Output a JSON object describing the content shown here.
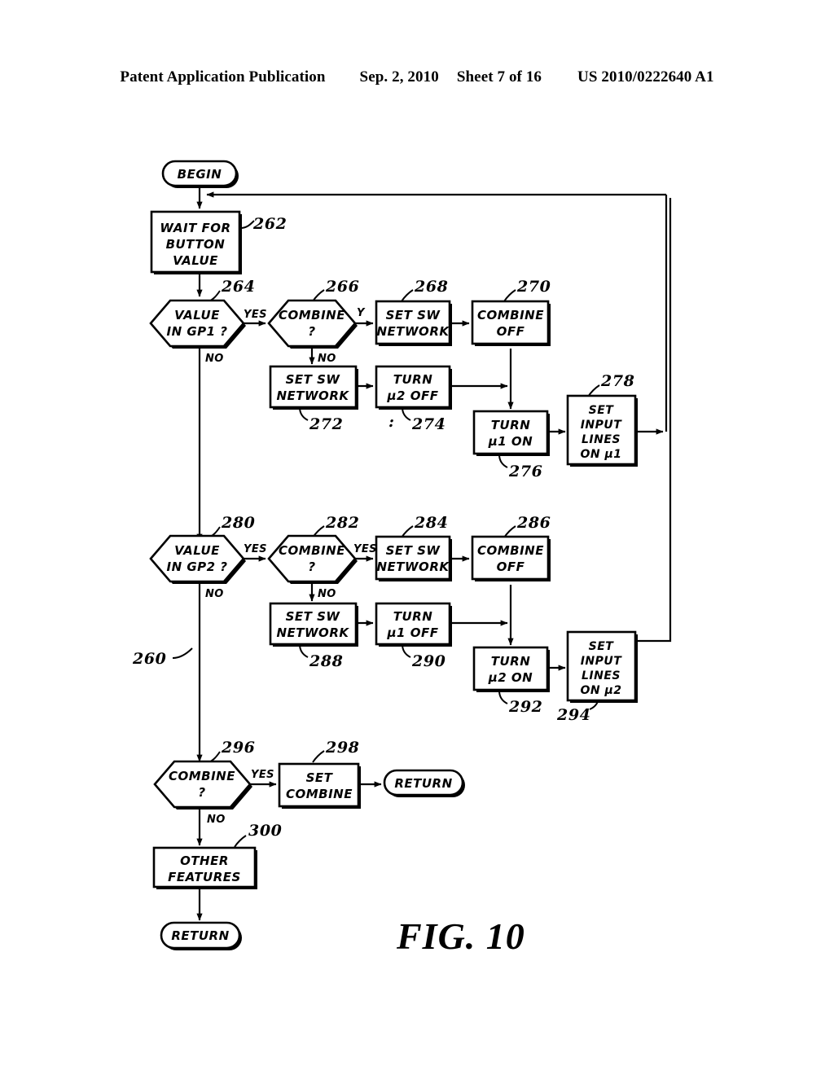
{
  "header": {
    "publication": "Patent Application Publication",
    "date": "Sep. 2, 2010",
    "sheet": "Sheet 7 of 16",
    "number": "US 2010/0222640 A1"
  },
  "figure": {
    "title": "FIG. 10",
    "diagram_ref": "260"
  },
  "nodes": [
    {
      "id": "begin",
      "type": "terminal",
      "label": "BEGIN",
      "ref": ""
    },
    {
      "id": "n262",
      "type": "process",
      "label": "WAIT FOR\nBUTTON\nVALUE",
      "ref": "262"
    },
    {
      "id": "n264",
      "type": "decision",
      "label": "VALUE\nIN GP1 ?",
      "ref": "264"
    },
    {
      "id": "n266",
      "type": "decision",
      "label": "COMBINE\n?",
      "ref": "266"
    },
    {
      "id": "n268",
      "type": "process",
      "label": "SET SW\nNETWORK",
      "ref": "268"
    },
    {
      "id": "n270",
      "type": "process",
      "label": "COMBINE\nOFF",
      "ref": "270"
    },
    {
      "id": "n272",
      "type": "process",
      "label": "SET SW\nNETWORK",
      "ref": "272"
    },
    {
      "id": "n274",
      "type": "process",
      "label": "TURN\nµ2 OFF",
      "ref": "274"
    },
    {
      "id": "n276",
      "type": "process",
      "label": "TURN\nµ1 ON",
      "ref": "276"
    },
    {
      "id": "n278",
      "type": "process",
      "label": "SET\nINPUT\nLINES\nON µ1",
      "ref": "278"
    },
    {
      "id": "n280",
      "type": "decision",
      "label": "VALUE\nIN GP2 ?",
      "ref": "280"
    },
    {
      "id": "n282",
      "type": "decision",
      "label": "COMBINE\n?",
      "ref": "282"
    },
    {
      "id": "n284",
      "type": "process",
      "label": "SET SW\nNETWORK",
      "ref": "284"
    },
    {
      "id": "n286",
      "type": "process",
      "label": "COMBINE\nOFF",
      "ref": "286"
    },
    {
      "id": "n288",
      "type": "process",
      "label": "SET SW\nNETWORK",
      "ref": "288"
    },
    {
      "id": "n290",
      "type": "process",
      "label": "TURN\nµ1 OFF",
      "ref": "290"
    },
    {
      "id": "n292",
      "type": "process",
      "label": "TURN\nµ2 ON",
      "ref": "292"
    },
    {
      "id": "n294",
      "type": "process",
      "label": "SET\nINPUT\nLINES\nON µ2",
      "ref": "294"
    },
    {
      "id": "n296",
      "type": "decision",
      "label": "COMBINE\n?",
      "ref": "296"
    },
    {
      "id": "n298",
      "type": "process",
      "label": "SET\nCOMBINE",
      "ref": "298"
    },
    {
      "id": "ret1",
      "type": "terminal",
      "label": "RETURN",
      "ref": ""
    },
    {
      "id": "n300",
      "type": "process",
      "label": "OTHER\nFEATURES",
      "ref": "300"
    },
    {
      "id": "ret2",
      "type": "terminal",
      "label": "RETURN",
      "ref": ""
    }
  ],
  "node_text": {
    "begin": "BEGIN",
    "n262_l1": "WAIT FOR",
    "n262_l2": "BUTTON",
    "n262_l3": "VALUE",
    "n264_l1": "VALUE",
    "n264_l2": "IN GP1 ?",
    "n266_l1": "COMBINE",
    "n266_l2": "?",
    "n268_l1": "SET SW",
    "n268_l2": "NETWORK",
    "n270_l1": "COMBINE",
    "n270_l2": "OFF",
    "n272_l1": "SET SW",
    "n272_l2": "NETWORK",
    "n274_l1": "TURN",
    "n274_l2": "µ2 OFF",
    "n276_l1": "TURN",
    "n276_l2": "µ1 ON",
    "n278_l1": "SET",
    "n278_l2": "INPUT",
    "n278_l3": "LINES",
    "n278_l4": "ON µ1",
    "n280_l1": "VALUE",
    "n280_l2": "IN GP2 ?",
    "n282_l1": "COMBINE",
    "n282_l2": "?",
    "n284_l1": "SET SW",
    "n284_l2": "NETWORK",
    "n286_l1": "COMBINE",
    "n286_l2": "OFF",
    "n288_l1": "SET SW",
    "n288_l2": "NETWORK",
    "n290_l1": "TURN",
    "n290_l2": "µ1 OFF",
    "n292_l1": "TURN",
    "n292_l2": "µ2 ON",
    "n294_l1": "SET",
    "n294_l2": "INPUT",
    "n294_l3": "LINES",
    "n294_l4": "ON µ2",
    "n296_l1": "COMBINE",
    "n296_l2": "?",
    "n298_l1": "SET",
    "n298_l2": "COMBINE",
    "ret1": "RETURN",
    "n300_l1": "OTHER",
    "n300_l2": "FEATURES",
    "ret2": "RETURN"
  },
  "refs": {
    "r262": "262",
    "r264": "264",
    "r266": "266",
    "r268": "268",
    "r270": "270",
    "r272": "272",
    "r274": "274",
    "r276": "276",
    "r278": "278",
    "r280": "280",
    "r282": "282",
    "r284": "284",
    "r286": "286",
    "r288": "288",
    "r290": "290",
    "r292": "292",
    "r294": "294",
    "r296": "296",
    "r298": "298",
    "r300": "300",
    "r260": "260"
  },
  "edge_labels": {
    "e264_yes": "YES",
    "e264_no": "NO",
    "e266_y": "Y",
    "e266_no": "NO",
    "e280_yes": "YES",
    "e280_no": "NO",
    "e282_yes": "YES",
    "e282_no": "NO",
    "e296_yes": "YES",
    "e296_no": "NO"
  }
}
